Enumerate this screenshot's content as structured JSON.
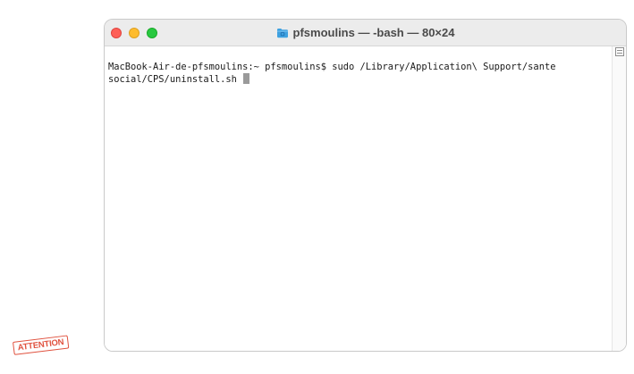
{
  "window": {
    "title": "pfsmoulins — -bash — 80×24"
  },
  "terminal": {
    "line1": "MacBook-Air-de-pfsmoulins:~ pfsmoulins$ sudo /Library/Application\\ Support/sante",
    "line2": "social/CPS/uninstall.sh "
  },
  "stamp": {
    "text": "ATTENTION"
  },
  "colors": {
    "close": "#fe5f57",
    "minimize": "#febc2e",
    "zoom": "#28c840",
    "stamp": "#e0523f",
    "folder_icon": "#3ea1e0"
  },
  "icons": {
    "title": "folder-icon"
  }
}
